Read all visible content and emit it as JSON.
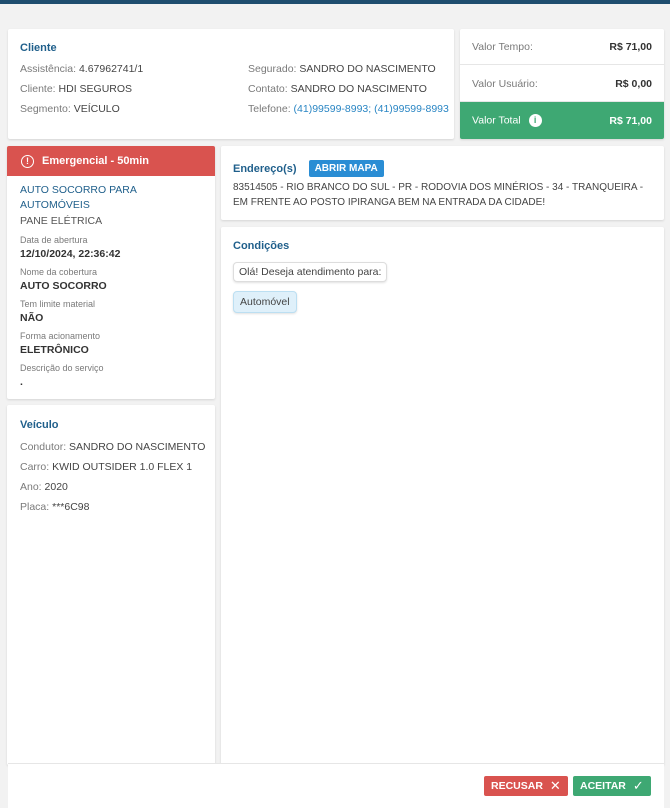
{
  "cliente": {
    "title": "Cliente",
    "assistencia_label": "Assistência:",
    "assistencia": "4.67962741/1",
    "cliente_label": "Cliente:",
    "cliente": "HDI SEGUROS",
    "segmento_label": "Segmento:",
    "segmento": "VEÍCULO",
    "segurado_label": "Segurado:",
    "segurado": "SANDRO DO NASCIMENTO",
    "contato_label": "Contato:",
    "contato": "SANDRO DO NASCIMENTO",
    "telefone_label": "Telefone:",
    "telefone": "(41)99599-8993; (41)99599-8993"
  },
  "valores": {
    "tempo_label": "Valor Tempo:",
    "tempo": "R$ 71,00",
    "usuario_label": "Valor Usuário:",
    "usuario": "R$ 0,00",
    "total_label": "Valor Total",
    "total": "R$ 71,00"
  },
  "servico": {
    "emergencia": "Emergencial - 50min",
    "tipo": "AUTO SOCORRO PARA AUTOMÓVEIS",
    "subtipo": "PANE ELÉTRICA",
    "data_label": "Data de abertura",
    "data": "12/10/2024, 22:36:42",
    "cobertura_label": "Nome da cobertura",
    "cobertura": "AUTO SOCORRO",
    "limite_label": "Tem limite material",
    "limite": "NÃO",
    "forma_label": "Forma acionamento",
    "forma": "ELETRÔNICO",
    "descricao_label": "Descrição do serviço",
    "descricao": "."
  },
  "veiculo": {
    "title": "Veículo",
    "condutor_label": "Condutor:",
    "condutor": "SANDRO DO NASCIMENTO",
    "carro_label": "Carro:",
    "carro": "KWID OUTSIDER 1.0 FLEX 1",
    "ano_label": "Ano:",
    "ano": "2020",
    "placa_label": "Placa:",
    "placa": "***6C98"
  },
  "endereco": {
    "title": "Endereço(s)",
    "mapa_button": "ABRIR MAPA",
    "text": "83514505 - RIO BRANCO DO SUL - PR - RODOVIA DOS MINÉRIOS - 34 - TRANQUEIRA - EM FRENTE AO POSTO IPIRANGA BEM NA ENTRADA DA CIDADE!"
  },
  "condicoes": {
    "title": "Condições",
    "question": "Olá! Deseja atendimento para:",
    "option": "Automóvel"
  },
  "footer": {
    "recusar": "RECUSAR",
    "aceitar": "ACEITAR"
  },
  "colors": {
    "accent": "#1f5f8b",
    "success": "#3ea873",
    "danger": "#d9534f",
    "link": "#2a86c4"
  },
  "icons": {
    "info": "info-icon",
    "alert": "alert-circle-icon",
    "close": "close-icon",
    "check": "check-icon"
  }
}
